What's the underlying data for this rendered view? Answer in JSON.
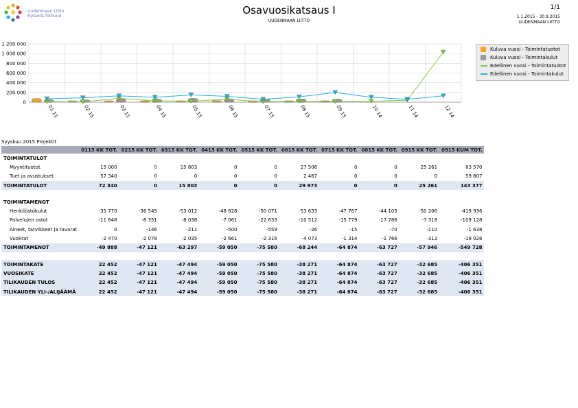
{
  "header": {
    "logo_text_line1": "Uudenmaan Liitto",
    "logo_text_line2": "Nylands förbund",
    "title": "Osavuosikatsaus I",
    "subtitle": "UUDENMAAN LIITTO",
    "page": "1/1",
    "date_range": "1.1.2015 - 30.9.2015",
    "org": "UUDENMAAN LIITTO"
  },
  "chart_data": {
    "type": "bar",
    "categories": [
      "01 15",
      "02 15",
      "03 15",
      "04 15",
      "05 15",
      "06 15",
      "07 15",
      "08 15",
      "09 15",
      "10 14",
      "11 14",
      "12 14"
    ],
    "y_ticks": [
      "1 200 000",
      "1 000 000",
      "800 000",
      "600 000",
      "400 000",
      "200 000",
      "0"
    ],
    "ylim": [
      0,
      1200000
    ],
    "grid": true,
    "legend_position": "right",
    "series": [
      {
        "name": "Kuluva vuosi - Toimintatuotot",
        "kind": "bar",
        "color": "#f5a623",
        "values": [
          72340,
          0,
          15803,
          0,
          0,
          29973,
          0,
          0,
          25261,
          null,
          null,
          null
        ]
      },
      {
        "name": "Kuluva vuosi - Toimintakulut",
        "kind": "bar",
        "color": "#9a9a9a",
        "values": [
          49888,
          47121,
          63297,
          59050,
          75580,
          68244,
          64874,
          63727,
          57946,
          null,
          null,
          null
        ]
      },
      {
        "name": "Edellinen vuosi - Toimintatuotot",
        "kind": "line",
        "color": "#8cc63f",
        "values": [
          10000,
          5000,
          80000,
          30000,
          20000,
          60000,
          10000,
          20000,
          15000,
          20000,
          40000,
          1030000
        ]
      },
      {
        "name": "Edellinen vuosi - Toimintakulut",
        "kind": "line",
        "color": "#29abe2",
        "values": [
          70000,
          90000,
          130000,
          100000,
          150000,
          120000,
          60000,
          110000,
          200000,
          100000,
          60000,
          130000
        ]
      }
    ]
  },
  "report": {
    "label": "Syyskuu 2015 Projektit",
    "columns": [
      "",
      "0115 KK TOT.",
      "0215 KK TOT.",
      "0315 KK TOT.",
      "0415 KK TOT.",
      "0515 KK TOT.",
      "0615 KK TOT.",
      "0715 KK TOT.",
      "0815 KK TOT.",
      "0915 KK TOT.",
      "0915 KUM TOT."
    ],
    "rows": [
      {
        "type": "sec",
        "cells": [
          "TOIMINTATULOT",
          "",
          "",
          "",
          "",
          "",
          "",
          "",
          "",
          "",
          ""
        ]
      },
      {
        "type": "item",
        "cells": [
          "Myyntituotot",
          "15 000",
          "0",
          "15 803",
          "0",
          "0",
          "27 506",
          "0",
          "0",
          "25 261",
          "83 570"
        ]
      },
      {
        "type": "item",
        "cells": [
          "Tuet ja avustukset",
          "57 340",
          "0",
          "0",
          "0",
          "0",
          "2 467",
          "0",
          "0",
          "0",
          "59 807"
        ]
      },
      {
        "type": "total",
        "cells": [
          "TOIMINTATULOT",
          "72 340",
          "0",
          "15 803",
          "0",
          "0",
          "29 973",
          "0",
          "0",
          "25 261",
          "143 377"
        ]
      },
      {
        "type": "spacer",
        "cells": [
          "",
          "",
          "",
          "",
          "",
          "",
          "",
          "",
          "",
          "",
          ""
        ]
      },
      {
        "type": "sec",
        "cells": [
          "TOIMINTAMENOT",
          "",
          "",
          "",
          "",
          "",
          "",
          "",
          "",
          "",
          ""
        ]
      },
      {
        "type": "item",
        "cells": [
          "Henkilöstökulut",
          "-35 770",
          "-36 545",
          "-53 012",
          "-48 828",
          "-50 071",
          "-53 633",
          "-47 767",
          "-44 105",
          "-50 206",
          "-419 936"
        ]
      },
      {
        "type": "item",
        "cells": [
          "Palvelujen ostot",
          "-11 648",
          "-8 351",
          "-8 038",
          "-7 061",
          "-22 633",
          "-10 512",
          "-15 779",
          "-17 786",
          "-7 318",
          "-109 128"
        ]
      },
      {
        "type": "item",
        "cells": [
          "Aineet, tarvikkeet ja tavarat",
          "0",
          "-146",
          "-211",
          "-500",
          "-559",
          "-26",
          "-15",
          "-70",
          "-110",
          "-1 638"
        ]
      },
      {
        "type": "item",
        "cells": [
          "Vuokrat",
          "-2 470",
          "-2 078",
          "-2 035",
          "-2 661",
          "-2 316",
          "-4 073",
          "-1 314",
          "-1 766",
          "-313",
          "-19 026"
        ]
      },
      {
        "type": "total",
        "cells": [
          "TOIMINTAMENOT",
          "-49 888",
          "-47 121",
          "-63 297",
          "-59 050",
          "-75 580",
          "-68 244",
          "-64 874",
          "-63 727",
          "-57 946",
          "-549 728"
        ]
      },
      {
        "type": "spacer",
        "cells": [
          "",
          "",
          "",
          "",
          "",
          "",
          "",
          "",
          "",
          "",
          ""
        ]
      },
      {
        "type": "summary",
        "cells": [
          "TOIMINTAKATE",
          "22 452",
          "-47 121",
          "-47 494",
          "-59 050",
          "-75 580",
          "-38 271",
          "-64 874",
          "-63 727",
          "-32 685",
          "-406 351"
        ]
      },
      {
        "type": "summary",
        "cells": [
          "VUOSIKATE",
          "22 452",
          "-47 121",
          "-47 494",
          "-59 050",
          "-75 580",
          "-38 271",
          "-64 874",
          "-63 727",
          "-32 685",
          "-406 351"
        ]
      },
      {
        "type": "summary",
        "cells": [
          "TILIKAUDEN TULOS",
          "22 452",
          "-47 121",
          "-47 494",
          "-59 050",
          "-75 580",
          "-38 271",
          "-64 874",
          "-63 727",
          "-32 685",
          "-406 351"
        ]
      },
      {
        "type": "summary",
        "cells": [
          "TILIKAUDEN YLI-/ALIJÄÄMÄ",
          "22 452",
          "-47 121",
          "-47 494",
          "-59 050",
          "-75 580",
          "-38 271",
          "-64 874",
          "-63 727",
          "-32 685",
          "-406 351"
        ]
      }
    ]
  }
}
